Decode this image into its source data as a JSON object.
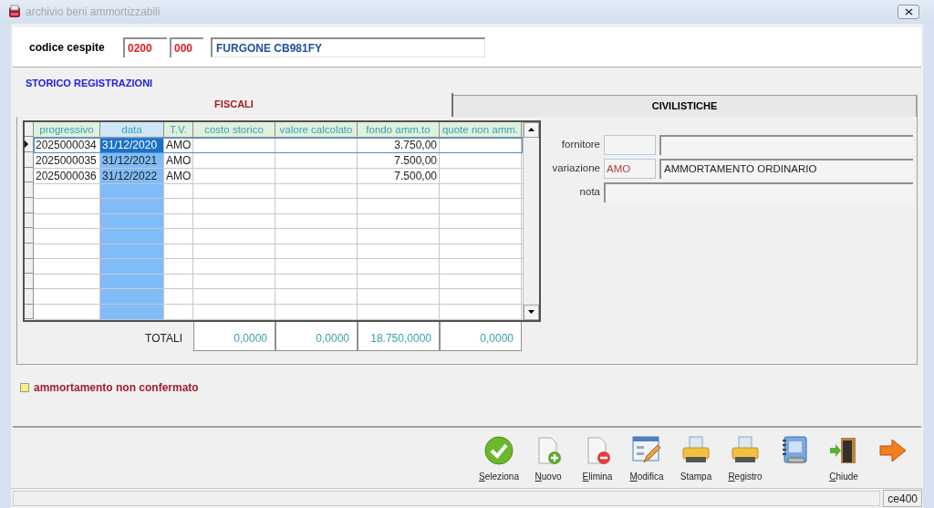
{
  "window": {
    "title": "archivio beni ammortizzabili"
  },
  "header": {
    "label": "codice cespite",
    "code_1": "0200",
    "code_2": "000",
    "description": "FURGONE CB981FY"
  },
  "section_title": "STORICO REGISTRAZIONI",
  "tabs": [
    {
      "label": "FISCALI",
      "selected": true
    },
    {
      "label": "CIVILISTICHE",
      "selected": false
    }
  ],
  "table": {
    "columns": [
      {
        "label": "progressivo",
        "selected": false
      },
      {
        "label": "data",
        "selected": true
      },
      {
        "label": "T.V.",
        "selected": false
      },
      {
        "label": "costo storico",
        "selected": false
      },
      {
        "label": "valore calcolato",
        "selected": false
      },
      {
        "label": "fondo amm.to",
        "selected": false
      },
      {
        "label": "quote non amm.",
        "selected": false
      }
    ],
    "rows": [
      {
        "selected": true,
        "cells": [
          "2025000034",
          "31/12/2020",
          "AMO",
          null,
          null,
          "3.750,00",
          null
        ]
      },
      {
        "selected": false,
        "cells": [
          "2025000035",
          "31/12/2021",
          "AMO",
          null,
          null,
          "7.500,00",
          null
        ]
      },
      {
        "selected": false,
        "cells": [
          "2025000036",
          "31/12/2022",
          "AMO",
          null,
          null,
          "7.500,00",
          null
        ]
      }
    ],
    "totals_label": "TOTALI",
    "totals": [
      "0,0000",
      "0,0000",
      "18.750,0000",
      "0,0000"
    ]
  },
  "details": [
    {
      "kind": "coded",
      "label": "fornitore"
    },
    {
      "kind": "coded",
      "label": "variazione",
      "code": "AMO",
      "value": "AMMORTAMENTO ORDINARIO"
    },
    {
      "kind": "plain",
      "label": "nota"
    }
  ],
  "legend": {
    "color": "#f5ee8c",
    "label": "ammortamento non confermato"
  },
  "toolbar": [
    {
      "kind": "select",
      "label": "Seleziona",
      "underlined_key": true
    },
    {
      "kind": "new",
      "label": "Nuovo",
      "underlined_key": true
    },
    {
      "kind": "delete",
      "label": "Elimina",
      "underlined_key": true
    },
    {
      "kind": "edit",
      "label": "Modifica",
      "underlined_key": true
    },
    {
      "kind": "print",
      "label": "Stampa",
      "underlined_key": false
    },
    {
      "kind": "print",
      "label": "Registro",
      "underlined_key": true
    },
    {
      "kind": "notebook"
    },
    {
      "kind": "exit",
      "label": "Chiude",
      "underlined_key": true
    },
    {
      "kind": "next"
    }
  ],
  "status_bar": {
    "code": "ce400"
  }
}
